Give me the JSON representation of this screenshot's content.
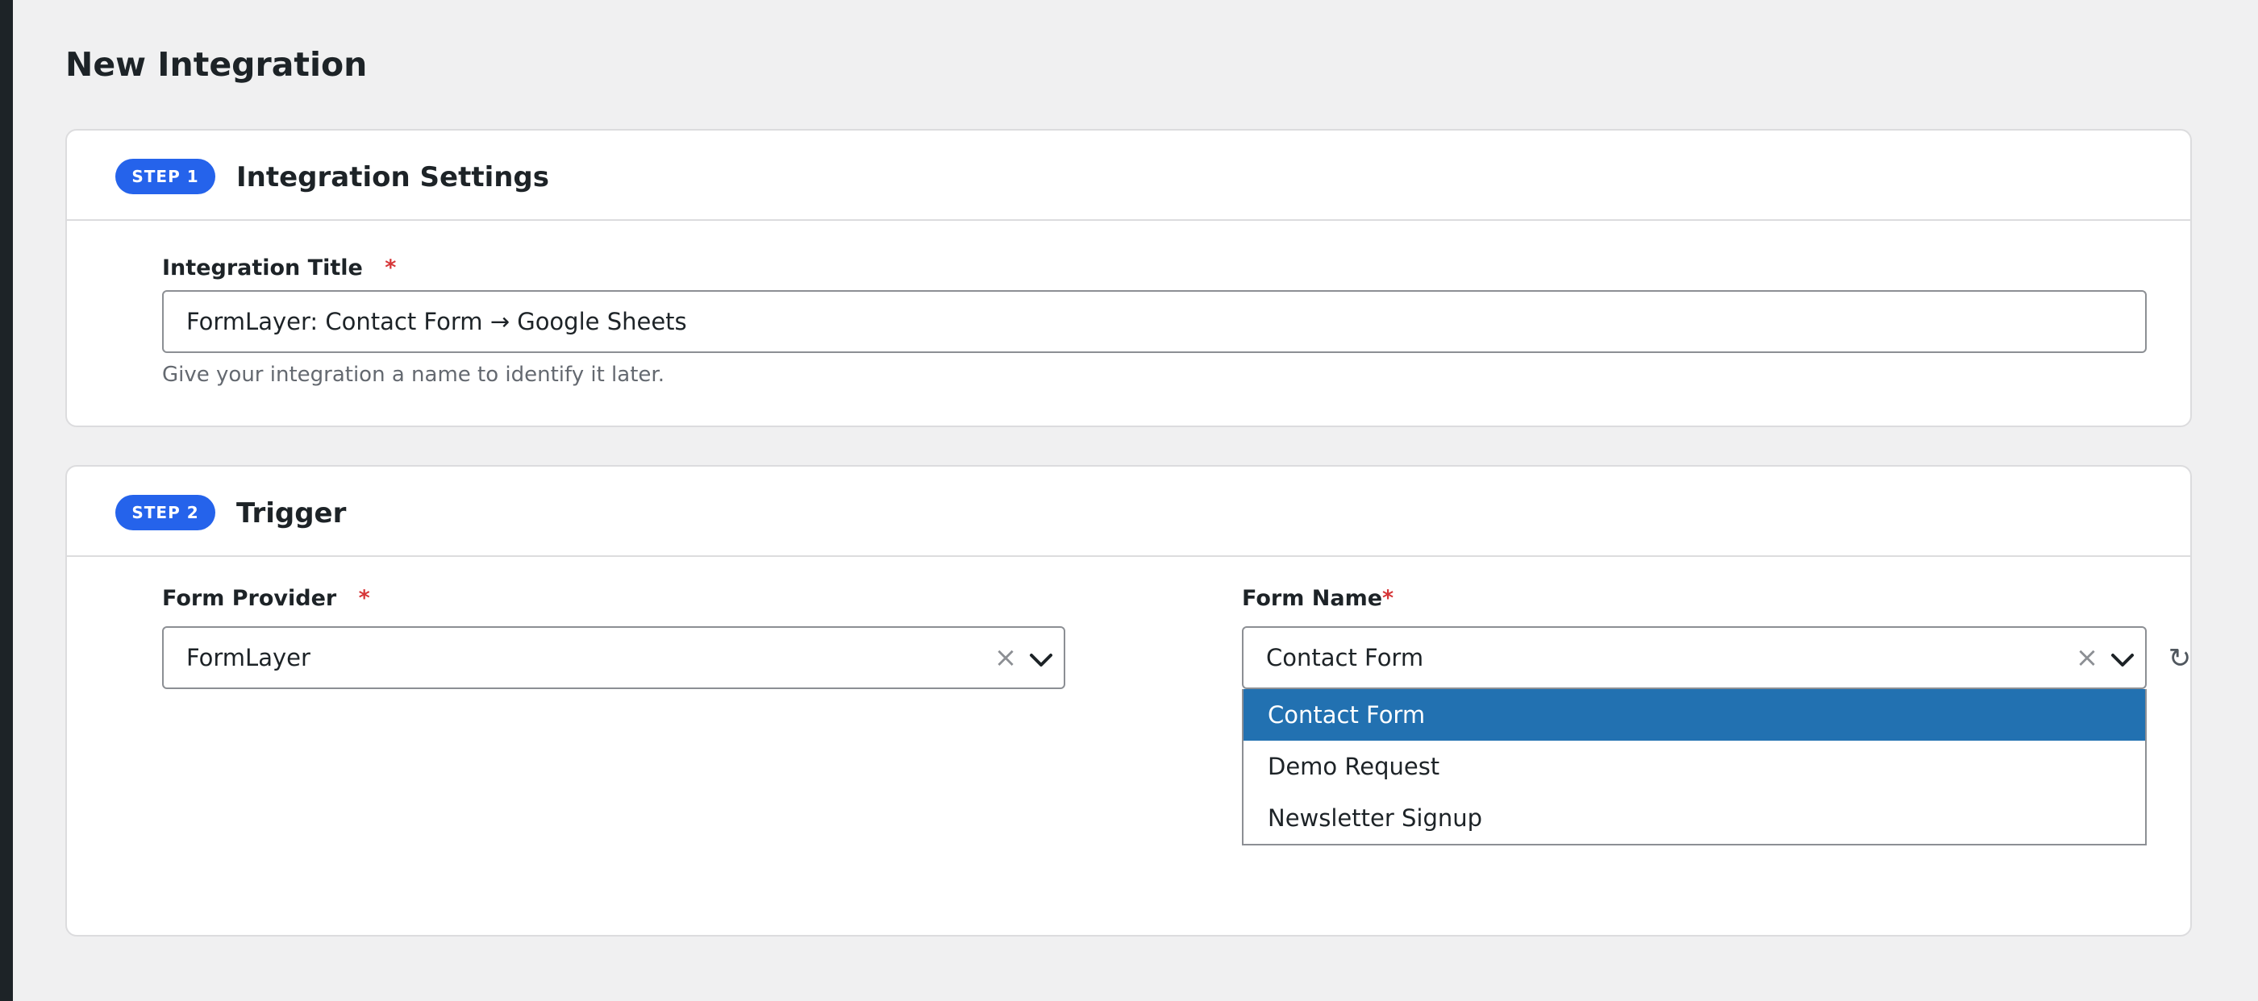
{
  "page": {
    "title": "New Integration"
  },
  "step1": {
    "badge": "STEP 1",
    "title": "Integration Settings",
    "integration_title": {
      "label": "Integration Title",
      "required_mark": "*",
      "value": "FormLayer: Contact Form → Google Sheets",
      "help": "Give your integration a name to identify it later."
    }
  },
  "step2": {
    "badge": "STEP 2",
    "title": "Trigger",
    "form_provider": {
      "label": "Form Provider",
      "required_mark": "*",
      "value": "FormLayer",
      "clear_icon": "×"
    },
    "form_name": {
      "label": "Form Name",
      "required_mark": "*",
      "value": "Contact Form",
      "clear_icon": "×",
      "options": [
        "Contact Form",
        "Demo Request",
        "Newsletter Signup"
      ],
      "highlighted_option": "Contact Form"
    },
    "refresh_icon": "↻"
  },
  "colors": {
    "step_badge": "#2563eb",
    "option_highlight": "#2271b1",
    "required": "#d63638",
    "background": "#f0f0f1"
  }
}
